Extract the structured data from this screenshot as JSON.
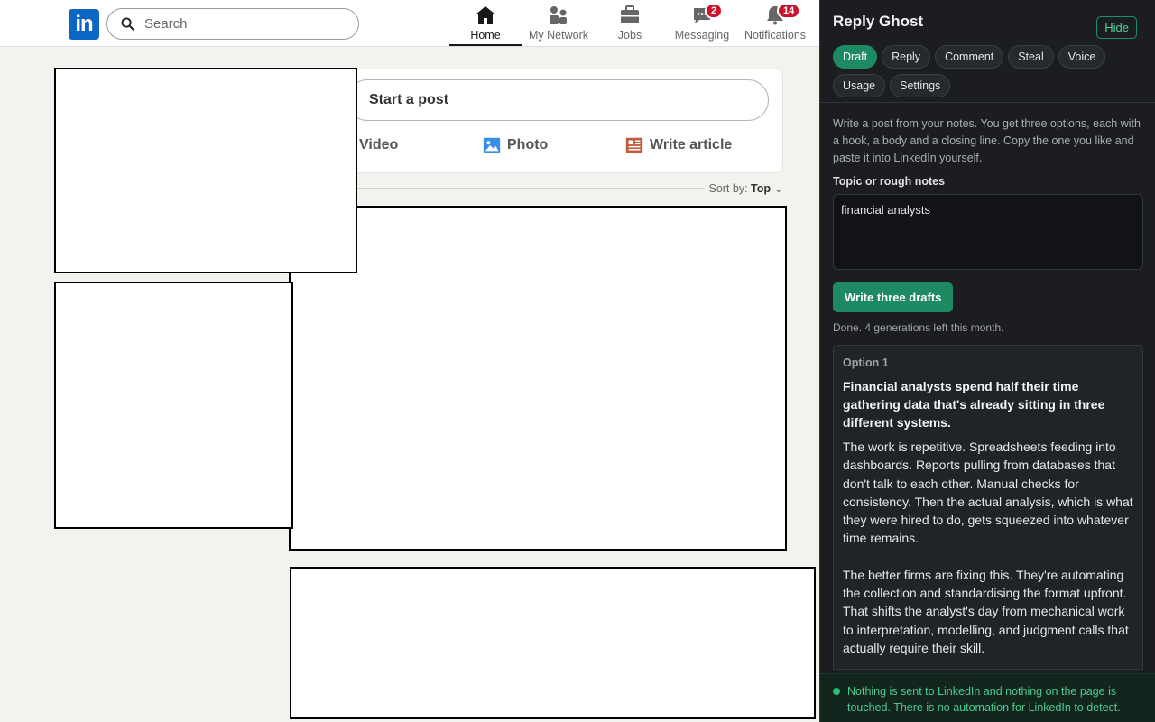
{
  "nav": {
    "logo": "in",
    "search_placeholder": "Search",
    "items": [
      {
        "label": "Home",
        "icon": "home-icon",
        "active": true
      },
      {
        "label": "My Network",
        "icon": "network-icon"
      },
      {
        "label": "Jobs",
        "icon": "briefcase-icon"
      },
      {
        "label": "Messaging",
        "icon": "message-icon",
        "badge": "2"
      },
      {
        "label": "Notifications",
        "icon": "bell-icon",
        "badge": "14"
      }
    ]
  },
  "feed": {
    "start_post": "Start a post",
    "actions": {
      "video": "Video",
      "photo": "Photo",
      "article": "Write article"
    },
    "sort_prefix": "Sort by:",
    "sort_value": "Top"
  },
  "panel": {
    "title": "Reply Ghost",
    "hide_label": "Hide",
    "tabs": [
      "Draft",
      "Reply",
      "Comment",
      "Steal",
      "Voice",
      "Usage",
      "Settings"
    ],
    "active_tab": "Draft",
    "intro": "Write a post from your notes. You get three options, each with a hook, a body and a closing line. Copy the one you like and paste it into LinkedIn yourself.",
    "notes_label": "Topic or rough notes",
    "notes_value": "financial analysts",
    "generate_label": "Write three drafts",
    "status": "Done. 4 generations left this month.",
    "option": {
      "label": "Option 1",
      "hook": "Financial analysts spend half their time gathering data that's already sitting in three different systems.",
      "body1": "The work is repetitive. Spreadsheets feeding into dashboards. Reports pulling from databases that don't talk to each other. Manual checks for consistency. Then the actual analysis, which is what they were hired to do, gets squeezed into whatever time remains.",
      "body2": "The better firms are fixing this. They're automating the collection and standardising the format upfront. That shifts the analyst's day from mechanical work to interpretation, modelling, and judgment calls that actually require their skill."
    },
    "footer": "Nothing is sent to LinkedIn and nothing on the page is touched. There is no automation for LinkedIn to detect."
  },
  "colors": {
    "linkedin_blue": "#0a66c2",
    "accent_green": "#1e8a63",
    "badge_red": "#cb112d"
  }
}
